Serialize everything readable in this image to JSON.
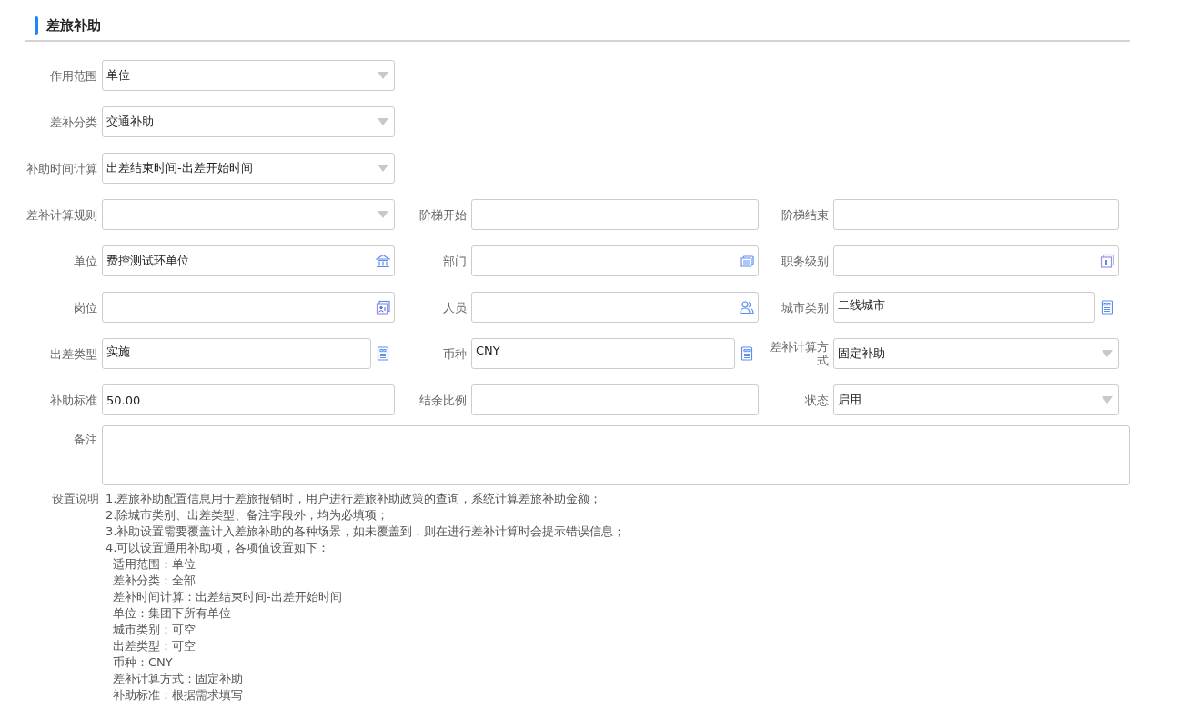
{
  "section": {
    "title": "差旅补助"
  },
  "rows": [
    [
      {
        "label": "作用范围",
        "kind": "select",
        "value": "单位"
      }
    ],
    [
      {
        "label": "差补分类",
        "kind": "select",
        "value": "交通补助"
      }
    ],
    [
      {
        "label": "补助时间计算",
        "kind": "select",
        "value": "出差结束时间-出差开始时间"
      }
    ],
    [
      {
        "label": "差补计算规则",
        "kind": "select"
      },
      {
        "label": "阶梯开始",
        "kind": "text"
      },
      {
        "label": "阶梯结束",
        "kind": "text"
      }
    ],
    [
      {
        "label": "单位",
        "kind": "building",
        "value": "费控测试环单位"
      },
      {
        "label": "部门",
        "kind": "folder"
      },
      {
        "label": "职务级别",
        "kind": "badge"
      }
    ],
    [
      {
        "label": "岗位",
        "kind": "card"
      },
      {
        "label": "人员",
        "kind": "people"
      },
      {
        "label": "城市类别",
        "kind": "lookup",
        "value": "二线城市"
      }
    ],
    [
      {
        "label": "出差类型",
        "kind": "lookup",
        "value": "实施"
      },
      {
        "label": "币种",
        "kind": "lookup",
        "value": "CNY"
      },
      {
        "label": "差补计算方式",
        "kind": "select",
        "value": "固定补助"
      }
    ],
    [
      {
        "label": "补助标准",
        "kind": "text",
        "value": "50.00"
      },
      {
        "label": "结余比例",
        "kind": "text"
      },
      {
        "label": "状态",
        "kind": "select",
        "value": "启用"
      }
    ]
  ],
  "remark": {
    "label": "备注"
  },
  "notes": {
    "label": "设置说明",
    "lines": [
      "1.差旅补助配置信息用于差旅报销时，用户进行差旅补助政策的查询，系统计算差旅补助金额；",
      "2.除城市类别、出差类型、备注字段外，均为必填项；",
      "3.补助设置需要覆盖计入差旅补助的各种场景，如未覆盖到，则在进行差补计算时会提示错误信息；",
      "4.可以设置通用补助项，各项值设置如下："
    ],
    "items": [
      "适用范围：单位",
      "差补分类：全部",
      "差补时间计算：出差结束时间-出差开始时间",
      "单位：集团下所有单位",
      "城市类别：可空",
      "出差类型：可空",
      "币种：CNY",
      "差补计算方式：固定补助",
      "补助标准：根据需求填写"
    ]
  }
}
